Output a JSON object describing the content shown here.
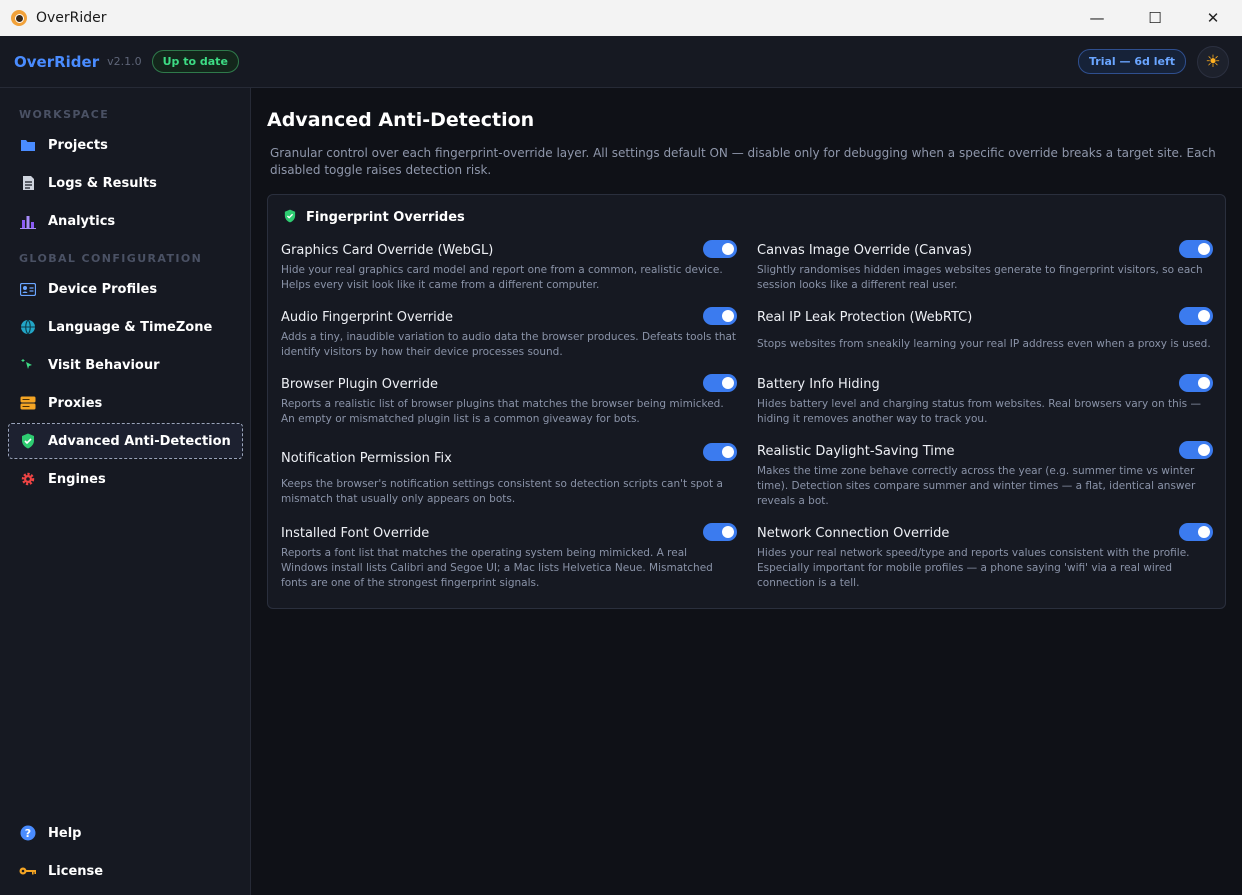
{
  "window": {
    "title": "OverRider",
    "controls": [
      "—",
      "☐",
      "✕"
    ]
  },
  "header": {
    "brand": "OverRider",
    "version": "v2.1.0",
    "status_badge": "Up to date",
    "trial_badge": "Trial — 6d left",
    "theme_icon": "sun-icon"
  },
  "sidebar": {
    "sections": [
      "WORKSPACE",
      "GLOBAL CONFIGURATION"
    ],
    "items": [
      {
        "label": "Projects",
        "icon": "folder-icon"
      },
      {
        "label": "Logs & Results",
        "icon": "document-icon"
      },
      {
        "label": "Analytics",
        "icon": "bar-chart-icon"
      },
      {
        "label": "Device Profiles",
        "icon": "id-card-icon"
      },
      {
        "label": "Language & TimeZone",
        "icon": "globe-icon"
      },
      {
        "label": "Visit Behaviour",
        "icon": "sparkle-cursor-icon"
      },
      {
        "label": "Proxies",
        "icon": "server-icon"
      },
      {
        "label": "Advanced Anti-Detection",
        "icon": "shield-icon",
        "active": true
      },
      {
        "label": "Engines",
        "icon": "gear-icon"
      }
    ],
    "footer": [
      {
        "label": "Help",
        "icon": "help-icon"
      },
      {
        "label": "License",
        "icon": "key-icon"
      }
    ]
  },
  "main": {
    "title": "Advanced Anti-Detection",
    "description": "Granular control over each fingerprint-override layer. All settings default ON — disable only for debugging when a specific override breaks a target site. Each disabled toggle raises detection risk.",
    "card": {
      "title": "Fingerprint Overrides",
      "icon": "shield-icon",
      "options": [
        {
          "title": "Graphics Card Override (WebGL)",
          "desc": "Hide your real graphics card model and report one from a common, realistic device. Helps every visit look like it came from a different computer.",
          "enabled": true
        },
        {
          "title": "Canvas Image Override (Canvas)",
          "desc": "Slightly randomises hidden images websites generate to fingerprint visitors, so each session looks like a different real user.",
          "enabled": true
        },
        {
          "title": "Audio Fingerprint Override",
          "desc": "Adds a tiny, inaudible variation to audio data the browser produces. Defeats tools that identify visitors by how their device processes sound.",
          "enabled": true
        },
        {
          "title": "Real IP Leak Protection (WebRTC)",
          "desc": "Stops websites from sneakily learning your real IP address even when a proxy is used.",
          "enabled": true
        },
        {
          "title": "Browser Plugin Override",
          "desc": "Reports a realistic list of browser plugins that matches the browser being mimicked. An empty or mismatched plugin list is a common giveaway for bots.",
          "enabled": true
        },
        {
          "title": "Battery Info Hiding",
          "desc": "Hides battery level and charging status from websites. Real browsers vary on this — hiding it removes another way to track you.",
          "enabled": true
        },
        {
          "title": "Notification Permission Fix",
          "desc": "Keeps the browser's notification settings consistent so detection scripts can't spot a mismatch that usually only appears on bots.",
          "enabled": true
        },
        {
          "title": "Realistic Daylight-Saving Time",
          "desc": "Makes the time zone behave correctly across the year (e.g. summer time vs winter time). Detection sites compare summer and winter times — a flat, identical answer reveals a bot.",
          "enabled": true
        },
        {
          "title": "Installed Font Override",
          "desc": "Reports a font list that matches the operating system being mimicked. A real Windows install lists Calibri and Segoe UI; a Mac lists Helvetica Neue. Mismatched fonts are one of the strongest fingerprint signals.",
          "enabled": true
        },
        {
          "title": "Network Connection Override",
          "desc": "Hides your real network speed/type and reports values consistent with the profile. Especially important for mobile profiles — a phone saying 'wifi' via a real wired connection is a tell.",
          "enabled": true
        }
      ]
    }
  }
}
